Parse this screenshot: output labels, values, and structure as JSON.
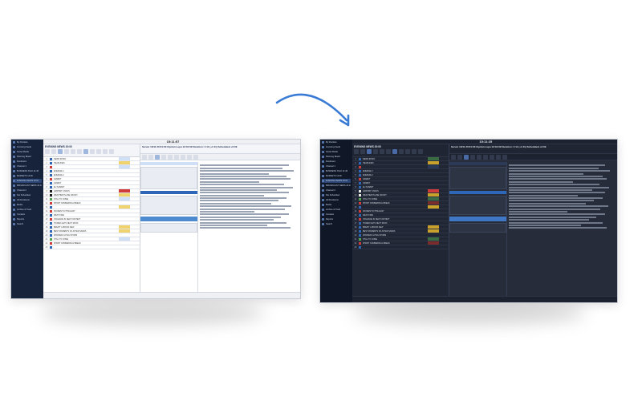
{
  "arrow": {
    "color": "#3a7bd5",
    "icon": "curved-arrow-icon"
  },
  "light_screenshot": {
    "clock": "15:11:57",
    "sidebar": [
      "My Dockets",
      "Incoming Feeds",
      "Social Media",
      "Planning Board",
      "Rundowns",
      "Channel 1",
      "BUSINESS TALK 11:45",
      "MARKETS 12:00",
      "EVENING NEWS 20:00",
      "BROADCAST NEWS 22:10",
      "Channel 2",
      "Not Scheduled",
      "All Rundowns",
      "Media",
      "Archive & Trash",
      "Contacts",
      "Reports",
      "Search"
    ],
    "rundown_title": "EVENING NEWS 20:00",
    "rows": [
      {
        "num": "1",
        "name": "NEWS INTRO",
        "flag": "#2f67b8",
        "tag": "#cfe0f6"
      },
      {
        "num": "2",
        "name": "HEADLINES",
        "flag": "#2f67b8",
        "tag": "#f1d36d"
      },
      {
        "num": "3",
        "name": "",
        "flag": "#cf3b3b",
        "tag": "#cfe0f6"
      },
      {
        "num": "4",
        "name": "ENERGIE 1",
        "flag": "#2f67b8",
        "tag": "#ffffff"
      },
      {
        "num": "5",
        "name": "ENERGIE 2",
        "flag": "#2f67b8",
        "tag": "#ffffff"
      },
      {
        "num": "6",
        "name": "SAMMIT",
        "flag": "#cf3b3b",
        "tag": "#ffffff"
      },
      {
        "num": "7",
        "name": "SAMMIT",
        "flag": "#2f67b8",
        "tag": "#ffffff"
      },
      {
        "num": "8",
        "name": "EU SUMMIT",
        "flag": "#2f67b8",
        "tag": "#ffffff"
      },
      {
        "num": "9",
        "name": "AIRPORT CHAOS",
        "flag": "#1e1e1e",
        "tag": "#cf3b3b"
      },
      {
        "num": "10",
        "name": "WEATHER PLANE CRASH",
        "flag": "#1e1e1e",
        "tag": "#f1d36d"
      },
      {
        "num": "11",
        "name": "STILL TO COME",
        "flag": "#4ea64e",
        "tag": "#cfe0f6"
      },
      {
        "num": "12",
        "name": "SPORT COMMERCIAL BREAK",
        "flag": "#cf3b3b",
        "tag": "#ffffff"
      },
      {
        "num": "13",
        "name": "",
        "flag": "#2f67b8",
        "tag": "#f1d36d"
      },
      {
        "num": "14",
        "name": "INCIDENT IN THE EAST",
        "flag": "#cf3b3b",
        "tag": "#ffffff"
      },
      {
        "num": "15",
        "name": "WEST FIRE",
        "flag": "#2f67b8",
        "tag": "#ffffff"
      },
      {
        "num": "16",
        "name": "VIOLENCE IN NEW CONTEXT",
        "flag": "#cf3b3b",
        "tag": "#ffffff"
      },
      {
        "num": "17",
        "name": "TOWER GETS NEXT ROOF",
        "flag": "#2f67b8",
        "tag": "#ffffff"
      },
      {
        "num": "18",
        "name": "BREXIT LABOUR NEW",
        "flag": "#2f67b8",
        "tag": "#f1d36d"
      },
      {
        "num": "19",
        "name": "BEST MOMENTS OF AFTER SANDS",
        "flag": "#2f67b8",
        "tag": "#f1d36d"
      },
      {
        "num": "20",
        "name": "WORKER FLYING STORM",
        "flag": "#2f67b8",
        "tag": "#ffffff"
      },
      {
        "num": "21",
        "name": "STILL TO COME",
        "flag": "#4ea64e",
        "tag": "#cfe0f6"
      },
      {
        "num": "22",
        "name": "SHORT COMMERCIAL BREAK",
        "flag": "#cf3b3b",
        "tag": "#ffffff"
      },
      {
        "num": "23",
        "name": "",
        "flag": "#2f67b8",
        "tag": "#ffffff"
      }
    ],
    "detail_header": "Server 10/11 20:01:00 Ciprian Lupu 12:31:02 Duration: 1:11 (+1:11) Scheduled +0:09"
  },
  "dark_screenshot": {
    "clock": "15:11:25",
    "sidebar": [
      "My Dockets",
      "Incoming Feeds",
      "Social Media",
      "Planning Board",
      "Rundowns",
      "Channel 1",
      "BUSINESS TALK 11:45",
      "MARKETS 12:00",
      "EVENING NEWS 20:00",
      "BROADCAST NEWS 22:10",
      "Channel 2",
      "Not Scheduled",
      "All Rundowns",
      "Media",
      "Archive & Trash",
      "Contacts",
      "Reports",
      "Search"
    ],
    "rundown_title": "EVENING NEWS 20:00",
    "rows": [
      {
        "num": "1",
        "name": "NEWS INTRO",
        "flag": "#2f67b8",
        "tag": "#3a6d44"
      },
      {
        "num": "2",
        "name": "HEADLINES",
        "flag": "#2f67b8",
        "tag": "#c9a12b"
      },
      {
        "num": "3",
        "name": "",
        "flag": "#cf3b3b",
        "tag": "#2a3a57"
      },
      {
        "num": "4",
        "name": "ENERGIE 1",
        "flag": "#2f67b8",
        "tag": "#202634"
      },
      {
        "num": "5",
        "name": "ENERGIE 2",
        "flag": "#2f67b8",
        "tag": "#202634"
      },
      {
        "num": "6",
        "name": "SAMMIT",
        "flag": "#cf3b3b",
        "tag": "#202634"
      },
      {
        "num": "7",
        "name": "SAMMIT",
        "flag": "#2f67b8",
        "tag": "#202634"
      },
      {
        "num": "8",
        "name": "EU SUMMIT",
        "flag": "#2f67b8",
        "tag": "#202634"
      },
      {
        "num": "9",
        "name": "AIRPORT CHAOS",
        "flag": "#e6e6e6",
        "tag": "#cf3b3b"
      },
      {
        "num": "10",
        "name": "WEATHER PLANE CRASH",
        "flag": "#e6e6e6",
        "tag": "#c9a12b"
      },
      {
        "num": "11",
        "name": "STILL TO COME",
        "flag": "#4ea64e",
        "tag": "#3a6d44"
      },
      {
        "num": "12",
        "name": "SPORT COMMERCIAL BREAK",
        "flag": "#cf3b3b",
        "tag": "#7a2b2b"
      },
      {
        "num": "13",
        "name": "",
        "flag": "#2f67b8",
        "tag": "#c9a12b"
      },
      {
        "num": "14",
        "name": "INCIDENT IN THE EAST",
        "flag": "#cf3b3b",
        "tag": "#202634"
      },
      {
        "num": "15",
        "name": "WEST FIRE",
        "flag": "#2f67b8",
        "tag": "#202634"
      },
      {
        "num": "16",
        "name": "VIOLENCE IN NEW CONTEXT",
        "flag": "#cf3b3b",
        "tag": "#202634"
      },
      {
        "num": "17",
        "name": "TOWER GETS NEXT ROOF",
        "flag": "#2f67b8",
        "tag": "#202634"
      },
      {
        "num": "18",
        "name": "BREXIT LABOUR NEW",
        "flag": "#2f67b8",
        "tag": "#c9a12b"
      },
      {
        "num": "19",
        "name": "BEST MOMENTS OF AFTER SANDS",
        "flag": "#2f67b8",
        "tag": "#c9a12b"
      },
      {
        "num": "20",
        "name": "WORKER FLYING STORM",
        "flag": "#2f67b8",
        "tag": "#202634"
      },
      {
        "num": "21",
        "name": "STILL TO COME",
        "flag": "#4ea64e",
        "tag": "#3a6d44"
      },
      {
        "num": "22",
        "name": "SHORT COMMERCIAL BREAK",
        "flag": "#cf3b3b",
        "tag": "#7a2b2b"
      },
      {
        "num": "23",
        "name": "",
        "flag": "#2f67b8",
        "tag": "#202634"
      }
    ],
    "detail_header": "Server 10/11 20:01:00 Ciprian Lupu 12:31:02 Duration: 1:11 (+1:11) Scheduled +0:09"
  }
}
